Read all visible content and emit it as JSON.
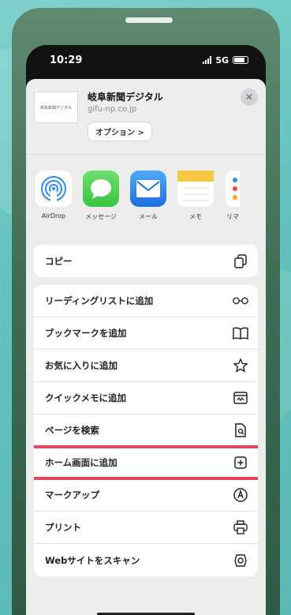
{
  "status": {
    "time": "10:29",
    "network": "5G"
  },
  "share": {
    "thumb_text": "岐阜新聞デジタル",
    "title": "岐阜新聞デジタル",
    "url": "gifu-np.co.jp",
    "options_label": "オプション >",
    "close_glyph": "✕"
  },
  "apps": [
    {
      "label": "AirDrop"
    },
    {
      "label": "メッセージ"
    },
    {
      "label": "メール"
    },
    {
      "label": "メモ"
    },
    {
      "label": "リマ"
    }
  ],
  "groups": {
    "copy": [
      {
        "label": "コピー",
        "icon": "copy-icon"
      }
    ],
    "actions": [
      {
        "label": "リーディングリストに追加",
        "icon": "glasses-icon"
      },
      {
        "label": "ブックマークを追加",
        "icon": "book-icon"
      },
      {
        "label": "お気に入りに追加",
        "icon": "star-icon"
      },
      {
        "label": "クイックメモに追加",
        "icon": "quick-note-icon"
      },
      {
        "label": "ページを検索",
        "icon": "find-page-icon"
      },
      {
        "label": "ホーム画面に追加",
        "icon": "plus-square-icon",
        "highlighted": true
      },
      {
        "label": "マークアップ",
        "icon": "markup-icon"
      },
      {
        "label": "プリント",
        "icon": "printer-icon"
      },
      {
        "label": "Webサイトをスキャン",
        "icon": "scan-icon"
      }
    ]
  },
  "colors": {
    "highlight": "#e8455c",
    "background": "#63c2bd",
    "phone": "#3f6d54"
  }
}
